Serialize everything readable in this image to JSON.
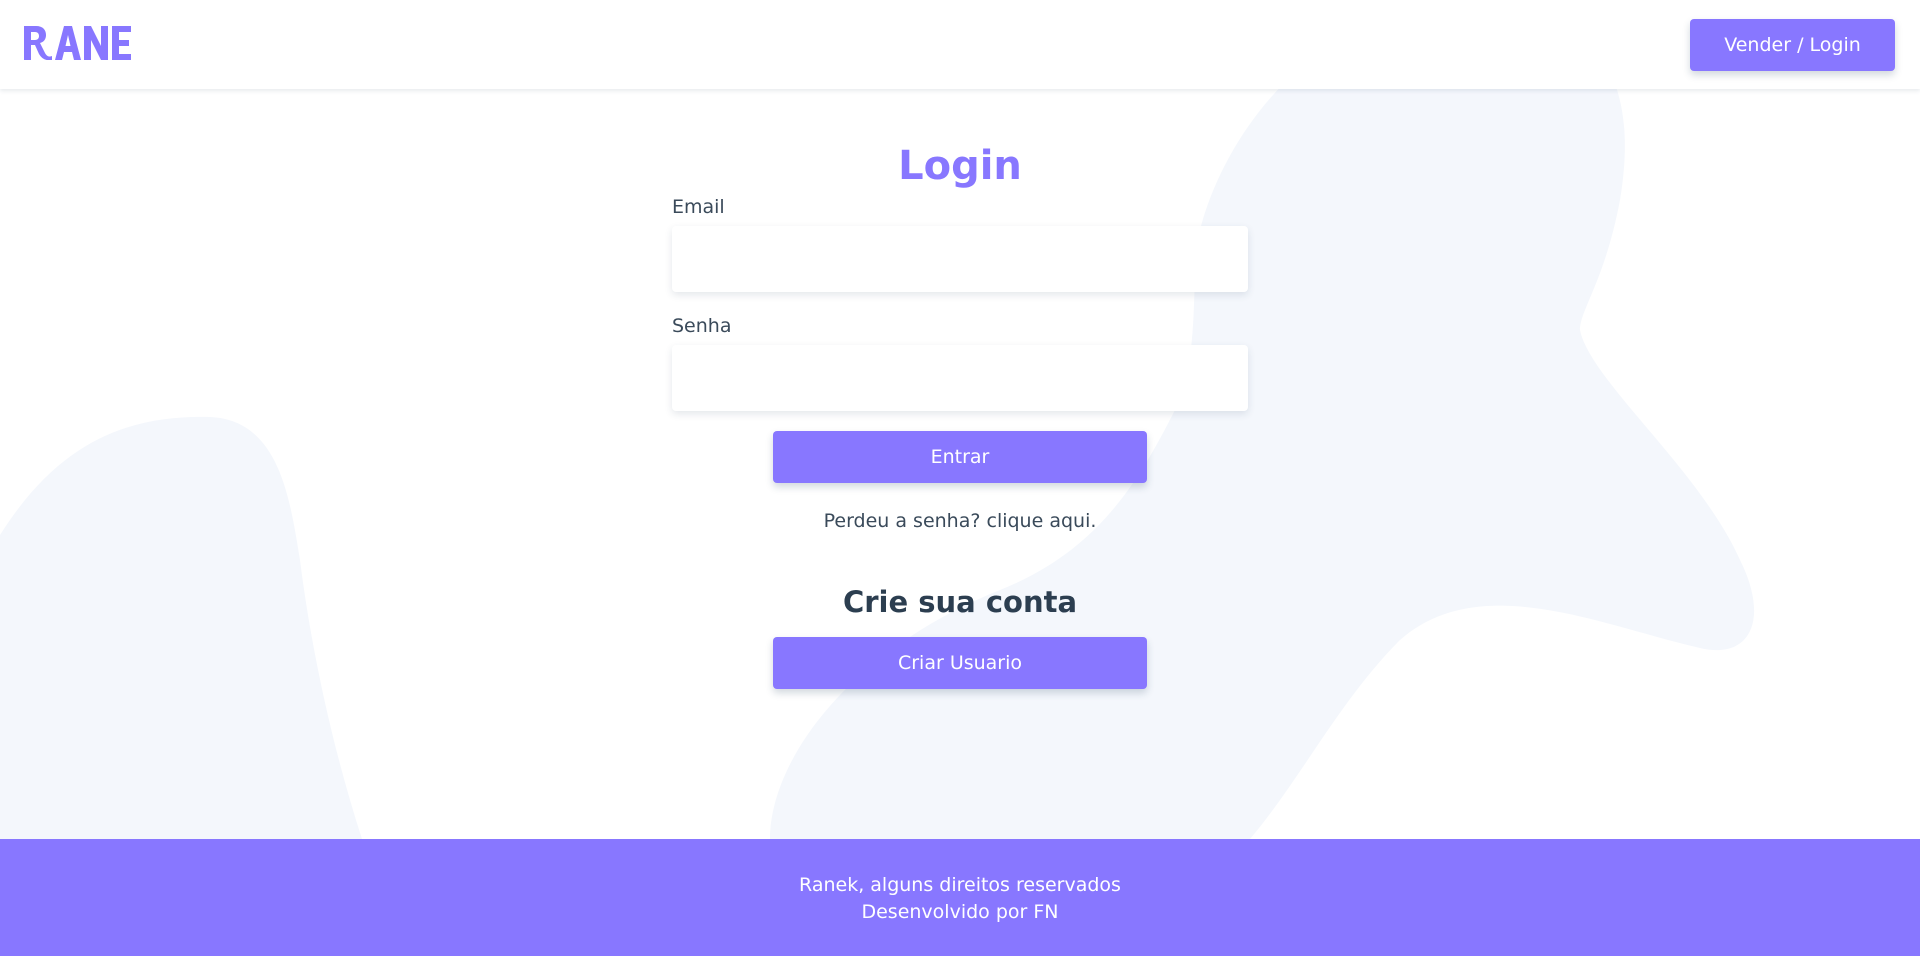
{
  "header": {
    "logo_alt": "RANEK",
    "login_button": "Vender / Login"
  },
  "login": {
    "title": "Login",
    "email_label": "Email",
    "email_value": "",
    "password_label": "Senha",
    "password_value": "",
    "submit_button": "Entrar",
    "lost_password_link": "Perdeu a senha? clique aqui."
  },
  "signup": {
    "title": "Crie sua conta",
    "button": "Criar Usuario"
  },
  "footer": {
    "line1": "Ranek, alguns direitos reservados",
    "line2": "Desenvolvido por FN"
  },
  "colors": {
    "accent": "#8877ff",
    "blob": "#f4f7fc",
    "text": "#2c3e50"
  },
  "icons": {
    "logo": "ranek-logo"
  }
}
